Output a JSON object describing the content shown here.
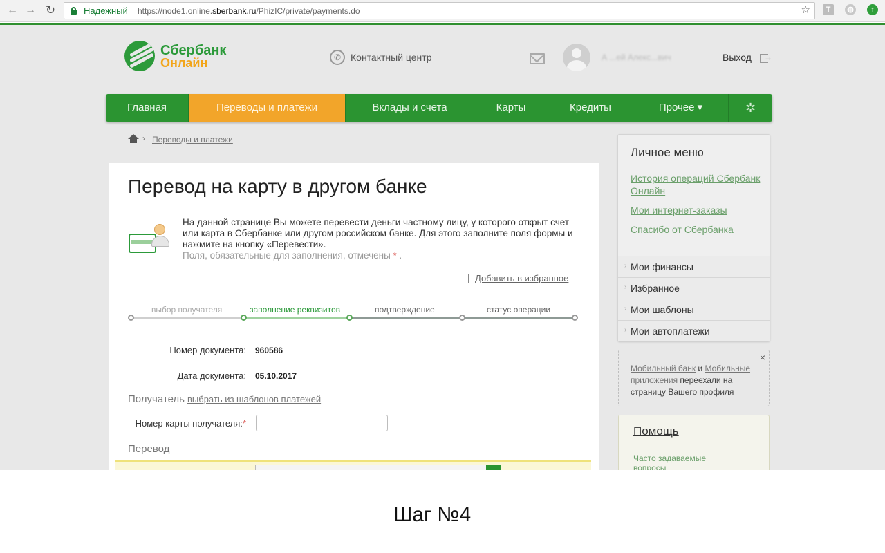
{
  "browser": {
    "secure_label": "Надежный",
    "url_prefix": "https://node1.online.",
    "url_domain": "sberbank.ru",
    "url_path": "/PhizIC/private/payments.do"
  },
  "header": {
    "logo_line1": "Сбербанк",
    "logo_line2": "Онлайн",
    "contact_center": "Контактный центр",
    "username": "А  ...ей  Алекс...вич",
    "logout": "Выход"
  },
  "menu": {
    "items": [
      {
        "label": "Главная"
      },
      {
        "label": "Переводы и платежи"
      },
      {
        "label": "Вклады и счета"
      },
      {
        "label": "Карты"
      },
      {
        "label": "Кредиты"
      },
      {
        "label": "Прочее ▾"
      }
    ]
  },
  "breadcrumb": {
    "link": "Переводы и платежи"
  },
  "form": {
    "title": "Перевод на карту в другом банке",
    "intro": "На данной странице Вы можете перевести деньги частному лицу, у которого открыт счет или карта в Сбербанке или другом российском банке. Для этого заполните поля формы и нажмите на кнопку «Перевести».",
    "required_note": "Поля, обязательные для заполнения, отмечены",
    "required_mark": "*",
    "required_end": ".",
    "favorite": "Добавить в избранное",
    "steps": [
      {
        "label": "выбор получателя"
      },
      {
        "label": "заполнение реквизитов"
      },
      {
        "label": "подтверждение"
      },
      {
        "label": "статус операции"
      }
    ],
    "doc_number_label": "Номер документа:",
    "doc_number": "960586",
    "doc_date_label": "Дата документа:",
    "doc_date": "05.10.2017",
    "recipient_section": "Получатель",
    "recipient_template_link": "выбрать из шаблонов платежей",
    "card_number_label": "Номер карты получателя:",
    "transfer_section": "Перевод"
  },
  "sidebar": {
    "title": "Личное меню",
    "links": [
      {
        "label": "История операций Сбербанк Онлайн"
      },
      {
        "label": "Мои интернет-заказы"
      },
      {
        "label": "Спасибо от Сбербанка"
      }
    ],
    "accordion": [
      {
        "label": "Мои финансы"
      },
      {
        "label": "Избранное"
      },
      {
        "label": "Мои шаблоны"
      },
      {
        "label": "Мои автоплатежи"
      }
    ]
  },
  "notice": {
    "link1": "Мобильный банк",
    "and": " и ",
    "link2": "Мобильные приложения",
    "text": " переехали на страницу Вашего профиля",
    "close": "×"
  },
  "help": {
    "title": "Помощь",
    "faq": "Часто задаваемые вопросы"
  },
  "caption": "Шаг №4",
  "colors": {
    "brand_green": "#2b9431",
    "active_orange": "#f2a52a",
    "logo_orange": "#f2a51a"
  }
}
